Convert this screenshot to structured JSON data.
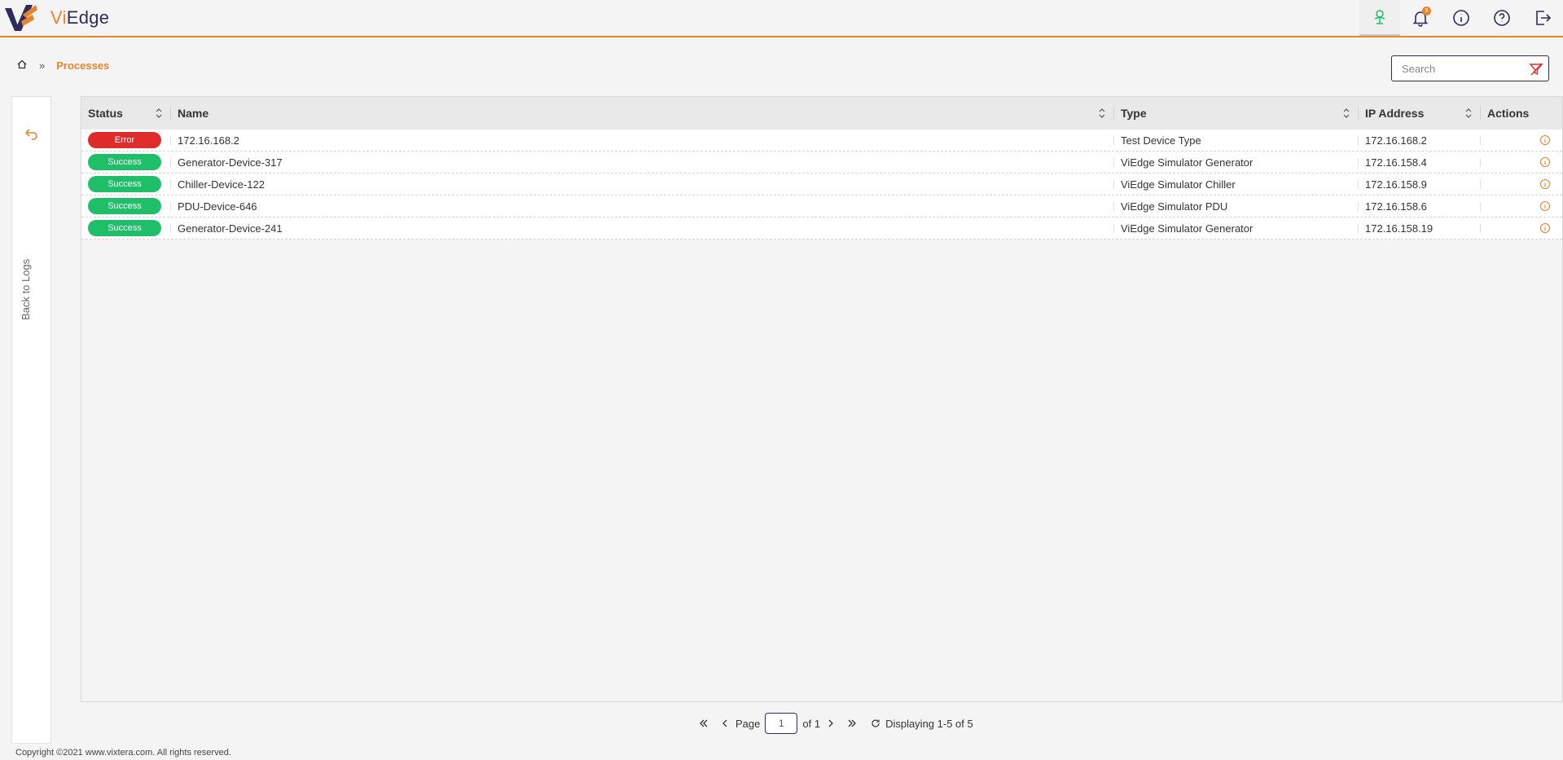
{
  "header": {
    "logo_vi": "Vi",
    "logo_edge": "Edge",
    "notification_count": "9",
    "icons": [
      "network-icon",
      "bell-icon",
      "info-icon",
      "help-icon",
      "logout-icon"
    ]
  },
  "breadcrumb": {
    "current": "Processes"
  },
  "search": {
    "placeholder": "Search"
  },
  "sidepanel": {
    "back_label": "Back to Logs"
  },
  "table": {
    "columns": {
      "status": "Status",
      "name": "Name",
      "type": "Type",
      "ip": "IP Address",
      "actions": "Actions"
    },
    "rows": [
      {
        "status": "Error",
        "name": "172.16.168.2",
        "type": "Test Device Type",
        "ip": "172.16.168.2"
      },
      {
        "status": "Success",
        "name": "Generator-Device-317",
        "type": "ViEdge Simulator Generator",
        "ip": "172.16.158.4"
      },
      {
        "status": "Success",
        "name": "Chiller-Device-122",
        "type": "ViEdge Simulator Chiller",
        "ip": "172.16.158.9"
      },
      {
        "status": "Success",
        "name": "PDU-Device-646",
        "type": "ViEdge Simulator PDU",
        "ip": "172.16.158.6"
      },
      {
        "status": "Success",
        "name": "Generator-Device-241",
        "type": "ViEdge Simulator Generator",
        "ip": "172.16.158.19"
      }
    ]
  },
  "pagination": {
    "page_label": "Page",
    "page_value": "1",
    "of_label": "of 1",
    "displaying": "Displaying 1-5 of 5"
  },
  "footer": {
    "copyright": "Copyright ©2021 www.vixtera.com. All rights reserved."
  },
  "colors": {
    "accent": "#e8842c",
    "brand_navy": "#2c2d5a",
    "error": "#e02b2b",
    "success": "#1fbf6a"
  }
}
